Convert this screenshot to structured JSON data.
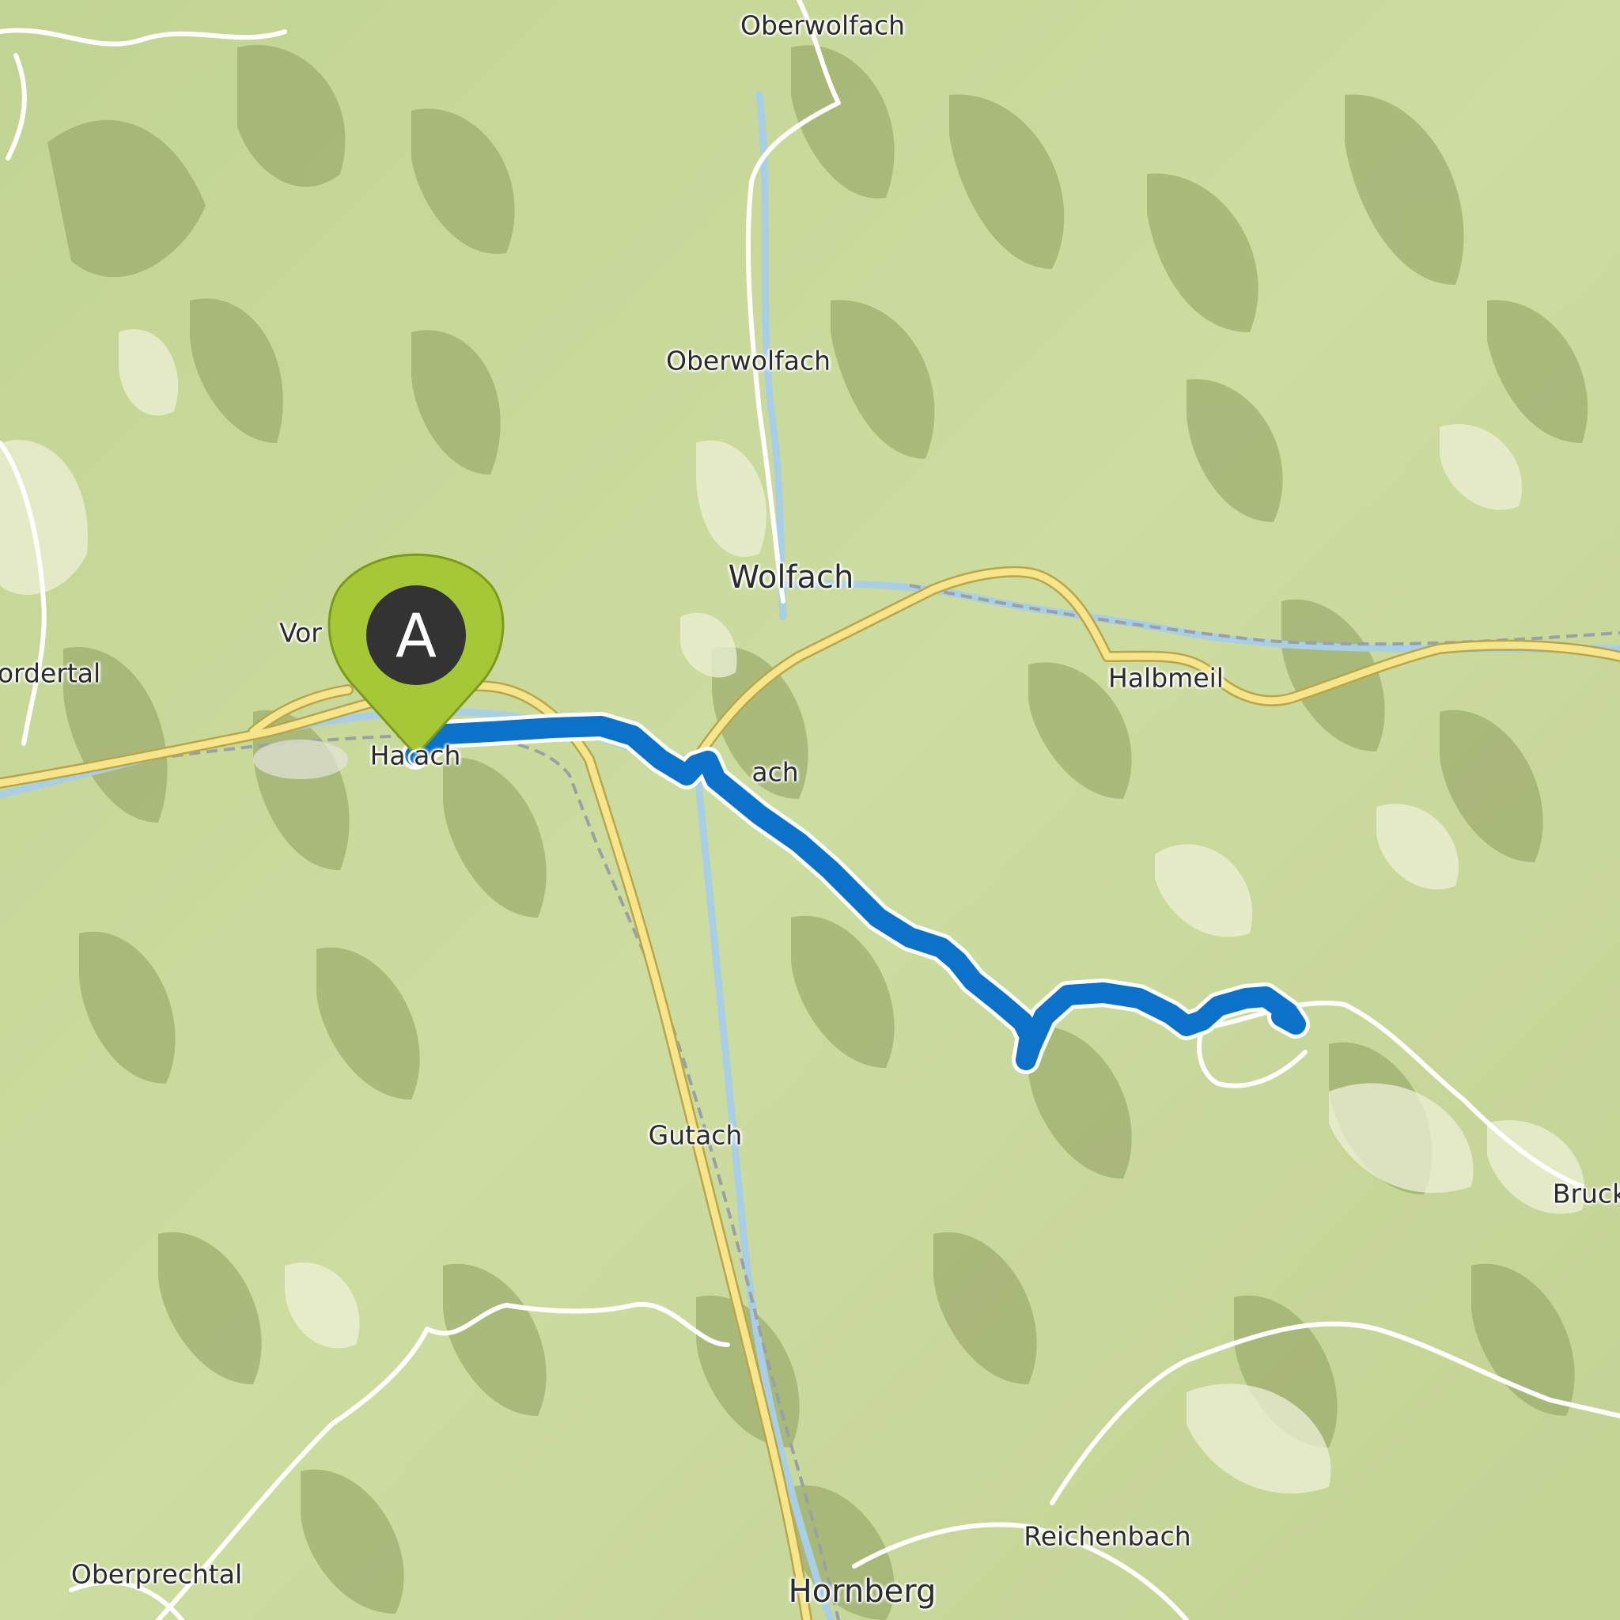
{
  "map": {
    "colors": {
      "forest": "#c9d99a",
      "forest_dark": "#8e9f5f",
      "meadow": "#eef0d6",
      "road_major": "#f6e58a",
      "road_minor": "#ffffff",
      "river": "#a9cfe6",
      "route": "#0c72c9",
      "marker_pin": "#a7c836",
      "marker_center": "#333333"
    },
    "labels": {
      "oberwolfach_top": "Oberwolfach",
      "oberwolfach_mid": "Oberwolfach",
      "wolfach": "Wolfach",
      "halbmeil": "Halbmeil",
      "vor": "Vor",
      "vordertal": "ordertal",
      "hausach": "Ha    ach",
      "gutach_bach": "ach",
      "gutach": "Gutach",
      "bruck": "Bruck",
      "reichenbach": "Reichenbach",
      "oberprechtal": "Oberprechtal",
      "hornberg": "Hornberg"
    },
    "marker": {
      "letter": "A",
      "icon": "map-pin-icon"
    }
  }
}
